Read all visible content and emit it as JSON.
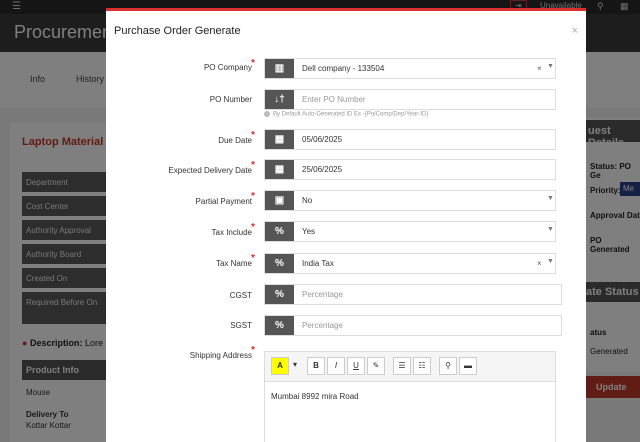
{
  "background": {
    "unavailable": "Unavailable",
    "title": "Procurement",
    "tabs": [
      "Info",
      "History"
    ],
    "panel_title": "Laptop Material",
    "rows": [
      "Department",
      "Cost Center",
      "Authority Approval",
      "Authority Board",
      "Created On",
      "Required Before On"
    ],
    "description_label": "Description:",
    "description_value": "Lore",
    "product_info": "Product Info",
    "product_item": "Mouse",
    "delivery_to_label": "Delivery To",
    "delivery_to_value": "Kottar Kottar",
    "right_head": "uest Details",
    "right_status": "Status: PO Ge",
    "right_priority": "Priority:",
    "right_priority_badge": "Me",
    "right_approval": "Approval Dat",
    "right_po": "PO Generated",
    "right_head2": "ate Status",
    "right_status2": "atus",
    "right_generated": "Generated",
    "update_button": "Update"
  },
  "modal": {
    "title": "Purchase Order Generate",
    "close": "×",
    "fields": {
      "po_company": {
        "label": "PO Company",
        "value": "Dell company - 133504",
        "icon": "building-icon"
      },
      "po_number": {
        "label": "PO Number",
        "placeholder": "Enter PO Number",
        "icon": "sort-icon",
        "hint": "By Default Auto-Generated ID Ex -{Po/Comp/Dep/Year-ID}"
      },
      "due_date": {
        "label": "Due Date",
        "value": "05/06/2025",
        "icon": "calendar-icon"
      },
      "expected_delivery": {
        "label": "Expected Delivery Date",
        "value": "25/06/2025",
        "icon": "calendar-icon"
      },
      "partial_payment": {
        "label": "Partial Payment",
        "value": "No",
        "icon": "money-icon"
      },
      "tax_include": {
        "label": "Tax Include",
        "value": "Yes",
        "icon": "percent-icon"
      },
      "tax_name": {
        "label": "Tax Name",
        "value": "India Tax",
        "icon": "percent-icon"
      },
      "cgst": {
        "label": "CGST",
        "placeholder": "Percentage",
        "icon": "percent-icon"
      },
      "sgst": {
        "label": "SGST",
        "placeholder": "Percentage",
        "icon": "percent-icon"
      },
      "shipping_address": {
        "label": "Shipping Address",
        "value": "Mumbai 8992 mira Road"
      }
    },
    "toolbar": {
      "color": "A",
      "dropdown": "▾",
      "bold": "B",
      "italic": "I",
      "underline": "U",
      "clear": "✎",
      "ul": "☰",
      "ol": "☷",
      "link": "⚲",
      "media": "▬"
    },
    "glyphs": {
      "clear": "×",
      "caret": "▼",
      "required": "*",
      "percent": "%"
    }
  }
}
